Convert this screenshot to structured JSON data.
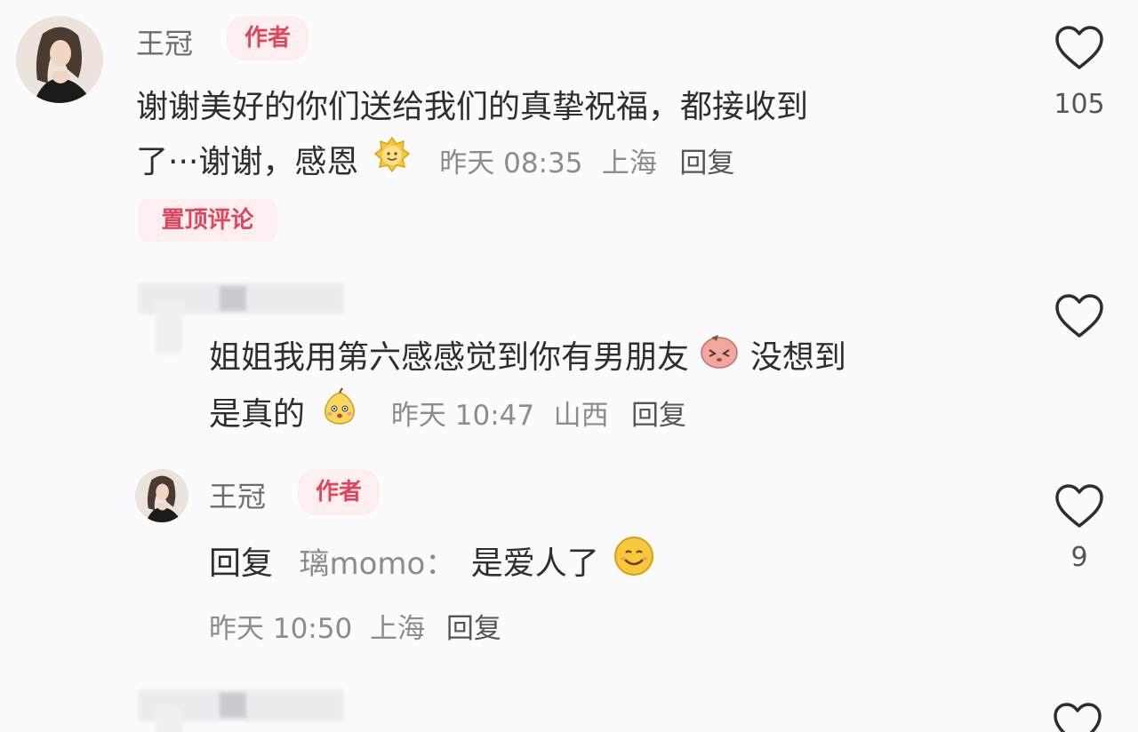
{
  "comments": [
    {
      "username": "王冠",
      "badge": "作者",
      "text_line1": "谢谢美好的你们送给我们的真挚祝福，都接收到",
      "text_line2": "了···谢谢，感恩",
      "emoji": "sparkle-face-emoji",
      "time": "昨天 08:35",
      "location": "上海",
      "reply": "回复",
      "pinned_label": "置顶评论",
      "likes": "105"
    },
    {
      "username": "",
      "text_line1": "姐姐我用第六感感觉到你有男朋友",
      "emoji_mid": "blush-face-emoji",
      "text_line1_tail": "没想到",
      "text_line2": "是真的",
      "emoji": "shy-pear-emoji",
      "time": "昨天 10:47",
      "location": "山西",
      "reply": "回复",
      "likes": ""
    },
    {
      "username": "王冠",
      "badge": "作者",
      "reply_prefix": "回复",
      "reply_to": "璃momo：",
      "text": "是爱人了",
      "emoji": "smile-face-emoji",
      "time": "昨天 10:50",
      "location": "上海",
      "reply": "回复",
      "likes": "9"
    }
  ],
  "colors": {
    "accent": "#e0455e",
    "badge_bg": "#fdeef0",
    "meta": "#8c8c8c"
  }
}
